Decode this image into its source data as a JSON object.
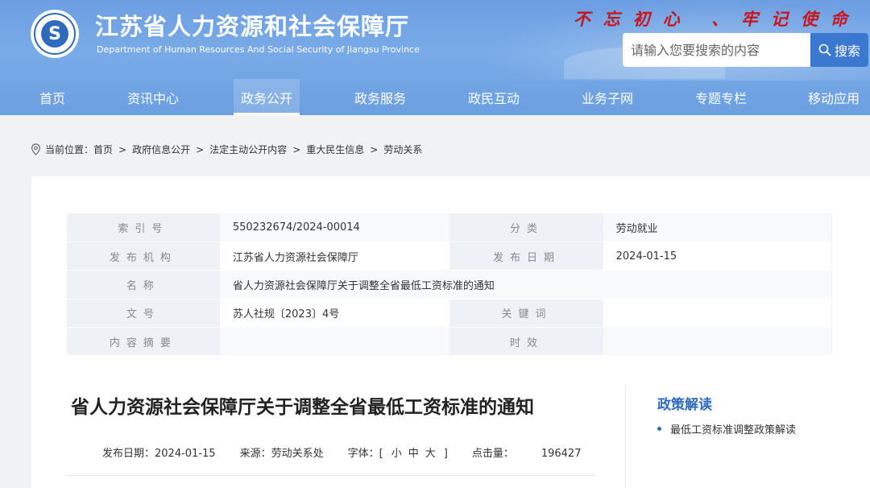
{
  "header": {
    "site_title": "江苏省人力资源和社会保障厅",
    "site_subtitle": "Department of Human Resources And Social Security of Jiangsu Province",
    "slogan": "不忘初心 、牢记使命",
    "search_placeholder": "请输入您要搜索的内容",
    "search_button": "搜索",
    "accent_color": "#3a79cf"
  },
  "nav": {
    "items": [
      "首页",
      "资讯中心",
      "政务公开",
      "政务服务",
      "政民互动",
      "业务子网",
      "专题专栏",
      "移动应用"
    ],
    "active": "政务公开"
  },
  "breadcrumb": {
    "prefix": "当前位置：",
    "items": [
      "首页",
      "政府信息公开",
      "法定主动公开内容",
      "重大民生信息",
      "劳动关系"
    ]
  },
  "meta": {
    "index_label": "索引号",
    "index_value": "550232674/2024-00014",
    "category_label": "分类",
    "category_value": "劳动就业",
    "issuer_label": "发布机构",
    "issuer_value": "江苏省人力资源社会保障厅",
    "date_label": "发布日期",
    "date_value": "2024-01-15",
    "name_label": "名称",
    "name_value": "省人力资源社会保障厅关于调整全省最低工资标准的通知",
    "docno_label": "文号",
    "docno_value": "苏人社规〔2023〕4号",
    "keywords_label": "关键词",
    "keywords_value": "",
    "summary_label": "内容摘要",
    "summary_value": "",
    "validity_label": "时效",
    "validity_value": ""
  },
  "article": {
    "title": "省人力资源社会保障厅关于调整全省最低工资标准的通知",
    "date_label": "发布日期：",
    "date": "2024-01-15",
    "source_label": "来源：",
    "source": "劳动关系处",
    "font_label": "字体：",
    "font_open": "[",
    "font_small": "小",
    "font_medium": "中",
    "font_large": "大",
    "font_close": "]",
    "clicks_label": "点击量：",
    "clicks": "196427"
  },
  "sidebar": {
    "title": "政策解读",
    "items": [
      "最低工资标准调整政策解读"
    ]
  }
}
